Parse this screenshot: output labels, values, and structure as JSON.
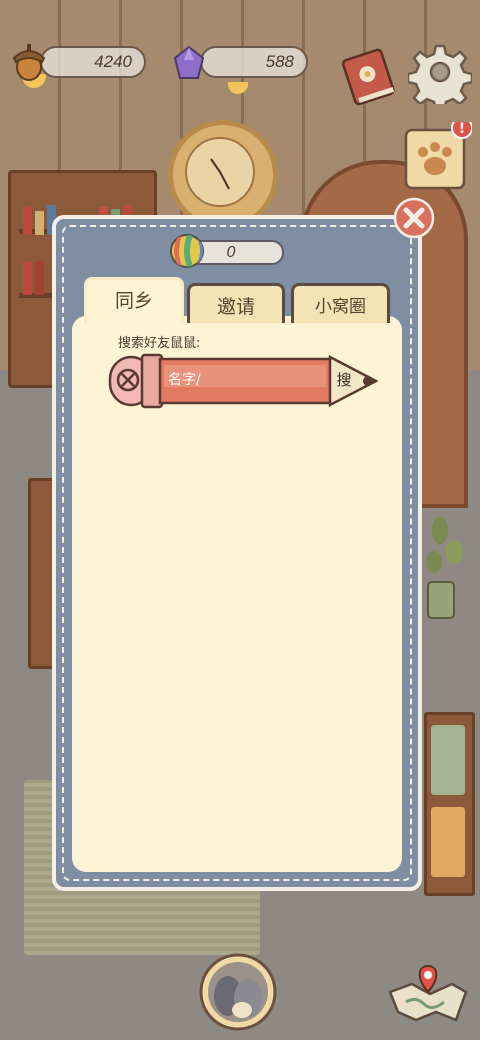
{
  "hud": {
    "acorns": "4240",
    "gems": "588"
  },
  "dialog": {
    "ball_count": "0",
    "tabs": [
      {
        "label": "同乡",
        "active": true
      },
      {
        "label": "邀请",
        "active": false
      },
      {
        "label": "小窝圈",
        "active": false
      }
    ],
    "search_label": "搜索好友鼠鼠:",
    "search_placeholder": "名字/",
    "search_button": "搜"
  },
  "colors": {
    "panel": "#7f8ea2",
    "content": "#fdf4d6",
    "pencil": "#e27a62",
    "notification": "#e0524a"
  },
  "icons": [
    "acorn-icon",
    "gem-icon",
    "journal-icon",
    "gear-icon",
    "paw-icon",
    "close-icon",
    "ball-icon",
    "character-icon",
    "map-icon"
  ]
}
